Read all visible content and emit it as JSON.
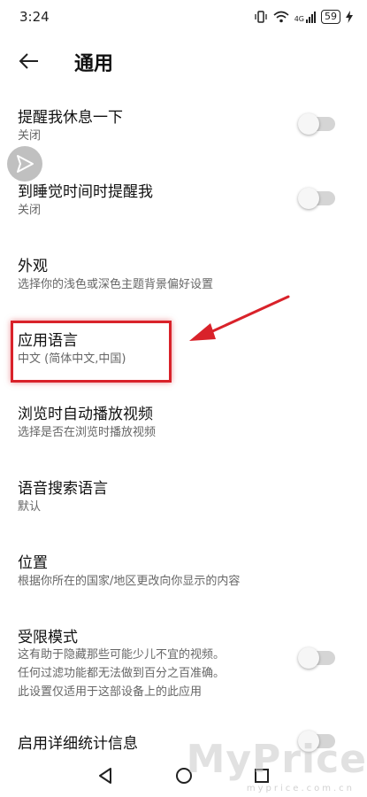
{
  "status_bar": {
    "time": "3:24",
    "signal_label": "4G",
    "battery": "59"
  },
  "app_bar": {
    "title": "通用",
    "back_icon": "arrow-left-icon"
  },
  "settings": [
    {
      "title": "提醒我休息一下",
      "subtitle": "关闭",
      "toggle": false
    },
    {
      "title": "到睡觉时间时提醒我",
      "subtitle": "关闭",
      "toggle": false
    },
    {
      "title": "外观",
      "subtitle": "选择你的浅色或深色主题背景偏好设置"
    },
    {
      "title": "应用语言",
      "subtitle": "中文 (简体中文,中国)"
    },
    {
      "title": "浏览时自动播放视频",
      "subtitle": "选择是否在浏览时播放视频"
    },
    {
      "title": "语音搜索语言",
      "subtitle": "默认"
    },
    {
      "title": "位置",
      "subtitle": "根据你所在的国家/地区更改向你显示的内容"
    },
    {
      "title": "受限模式",
      "subtitle_lines": [
        "这有助于隐藏那些可能少儿不宜的视频。",
        "任何过滤功能都无法做到百分之百准确。",
        "此设置仅适用于这部设备上的此应用"
      ],
      "toggle": false
    },
    {
      "title": "启用详细统计信息",
      "toggle": false
    }
  ],
  "annotation": {
    "color": "#d9222a"
  },
  "watermark": {
    "text": "MyPrice",
    "sub": "myprice.com.cn"
  }
}
